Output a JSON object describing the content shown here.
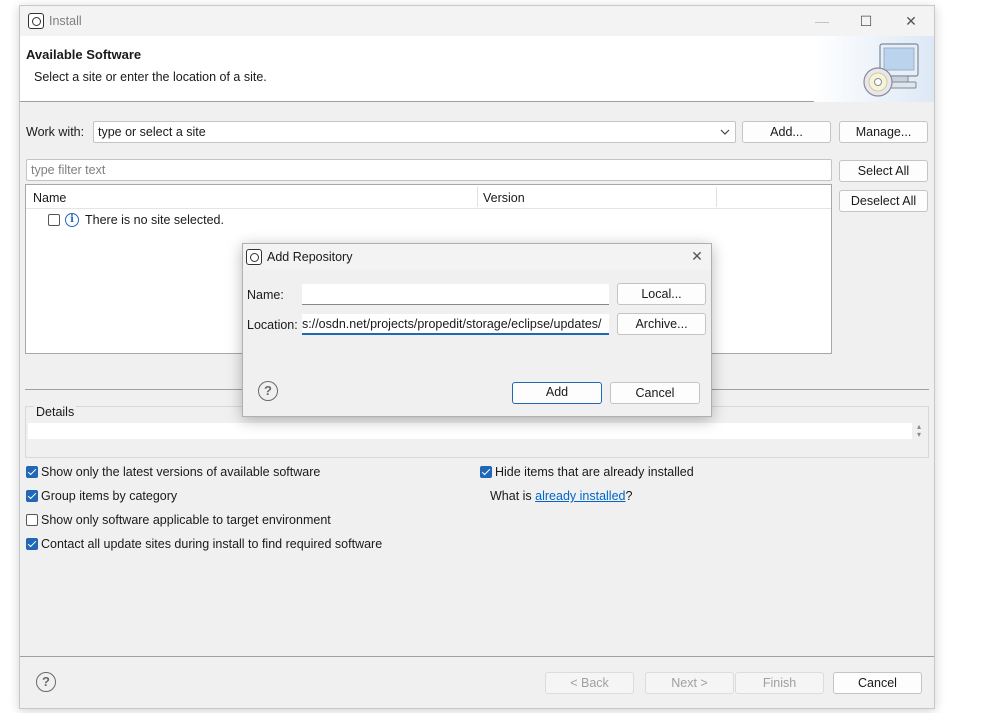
{
  "window": {
    "title": "Install",
    "controls": {
      "minimize": "—",
      "maximize": "☐",
      "close": "✕"
    }
  },
  "banner": {
    "title": "Available Software",
    "subtitle": "Select a site or enter the location of a site."
  },
  "work_with": {
    "label": "Work with:",
    "placeholder": "type or select a site",
    "add_label": "Add...",
    "manage_label": "Manage..."
  },
  "filter": {
    "placeholder": "type filter text",
    "select_all_label": "Select All",
    "deselect_all_label": "Deselect All"
  },
  "table": {
    "columns": [
      "Name",
      "Version"
    ],
    "rows": [
      {
        "label": "There is no site selected.",
        "checked": false
      }
    ]
  },
  "details": {
    "label": "Details"
  },
  "options": {
    "left": [
      {
        "label": "Show only the latest versions of available software",
        "checked": true
      },
      {
        "label": "Group items by category",
        "checked": true
      },
      {
        "label": "Show only software applicable to target environment",
        "checked": false
      },
      {
        "label": "Contact all update sites during install to find required software",
        "checked": true
      }
    ],
    "right": [
      {
        "label": "Hide items that are already installed",
        "checked": true
      }
    ],
    "what_is_prefix": "What is ",
    "what_is_link": "already installed",
    "what_is_suffix": "?"
  },
  "footer": {
    "back_label": "< Back",
    "next_label": "Next >",
    "finish_label": "Finish",
    "cancel_label": "Cancel"
  },
  "dialog": {
    "title": "Add Repository",
    "close": "✕",
    "name_label": "Name:",
    "name_value": "",
    "location_label": "Location:",
    "location_value": "s://osdn.net/projects/propedit/storage/eclipse/updates/",
    "local_label": "Local...",
    "archive_label": "Archive...",
    "add_label": "Add",
    "cancel_label": "Cancel"
  },
  "colors": {
    "accent": "#2067b6",
    "link": "#0066cc",
    "window_bg": "#f0f0f0"
  }
}
